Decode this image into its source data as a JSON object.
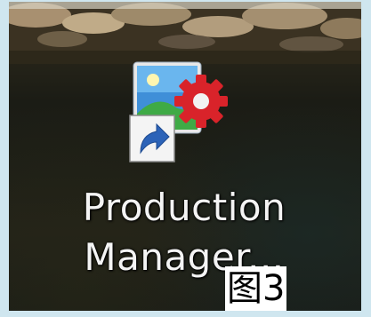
{
  "desktop_icon": {
    "label_line1": "Production",
    "label_line2": "Manager..."
  },
  "caption": "图3"
}
